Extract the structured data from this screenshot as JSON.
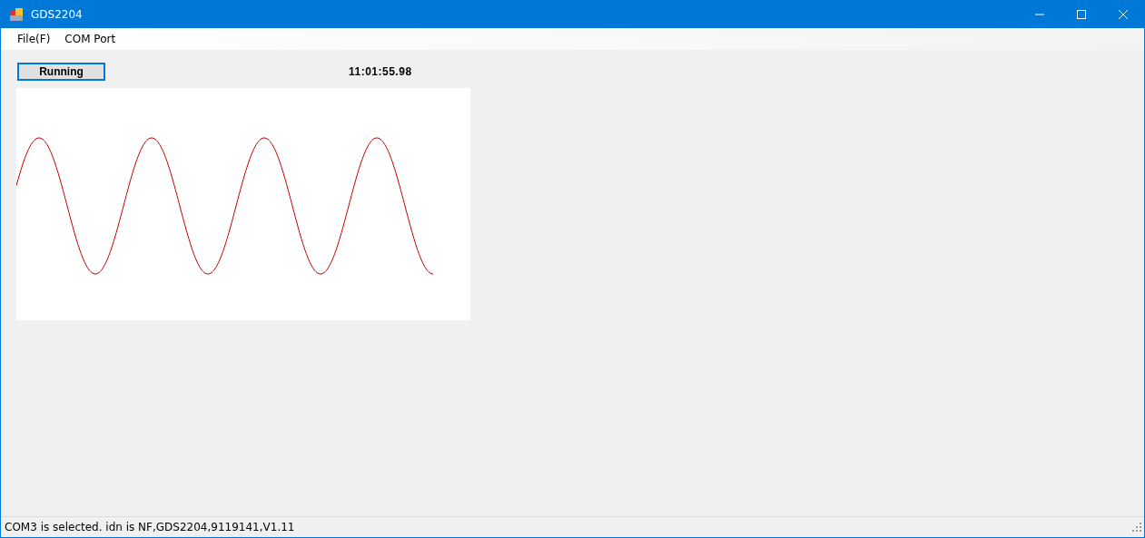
{
  "window": {
    "title": "GDS2204"
  },
  "menu": [
    "File(F)",
    "COM Port"
  ],
  "run_button": {
    "label": "Running"
  },
  "time": "11:01:55.98",
  "status_bar": "COM3 is selected. idn is NF,GDS2204,9119141,V1.11"
}
